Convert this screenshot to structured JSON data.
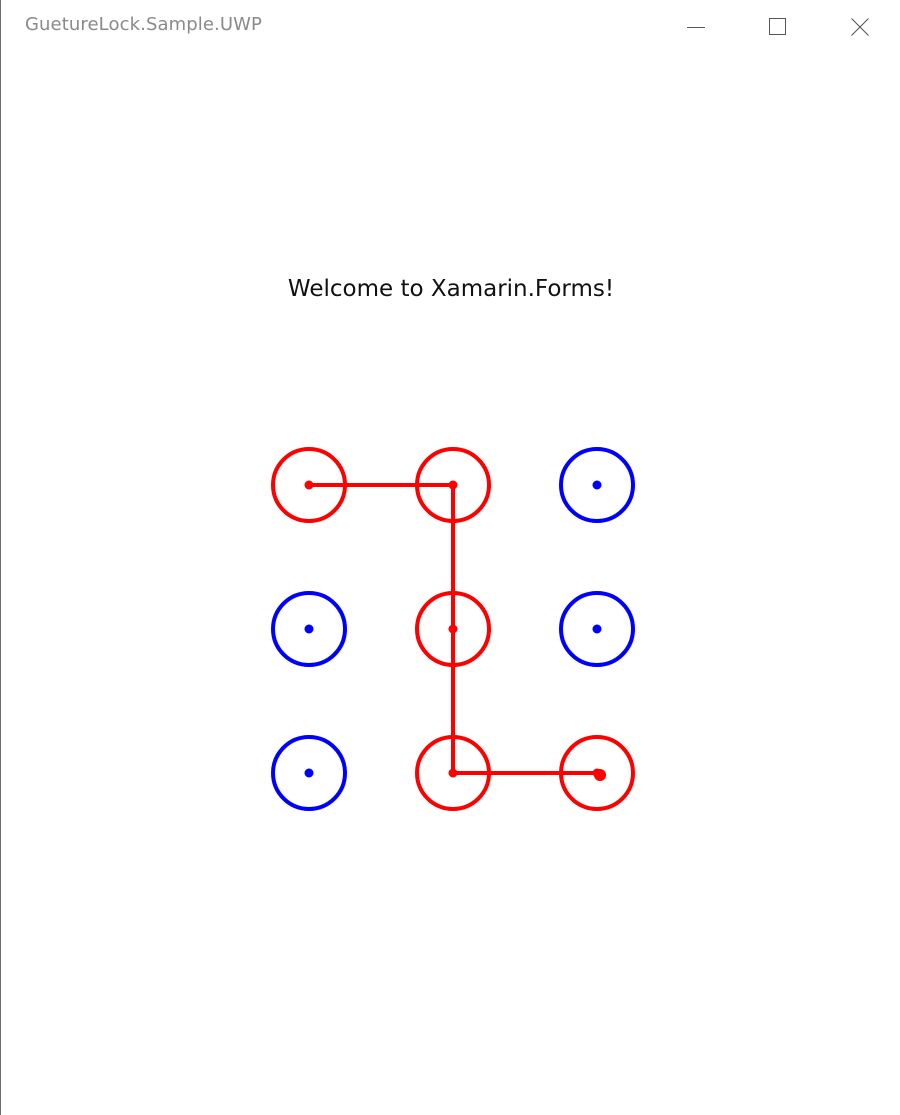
{
  "window": {
    "title": "GuetureLock.Sample.UWP",
    "controls": {
      "minimize": "minimize-icon",
      "maximize": "maximize-icon",
      "close": "close-icon"
    }
  },
  "content": {
    "welcome_text": "Welcome to Xamarin.Forms!"
  },
  "gesture_lock": {
    "grid": [
      3,
      3
    ],
    "selected_path": [
      0,
      1,
      4,
      7,
      8
    ],
    "colors": {
      "selected": "#ff0000",
      "unselected": "#0000ff",
      "background": "#ffffff"
    }
  }
}
